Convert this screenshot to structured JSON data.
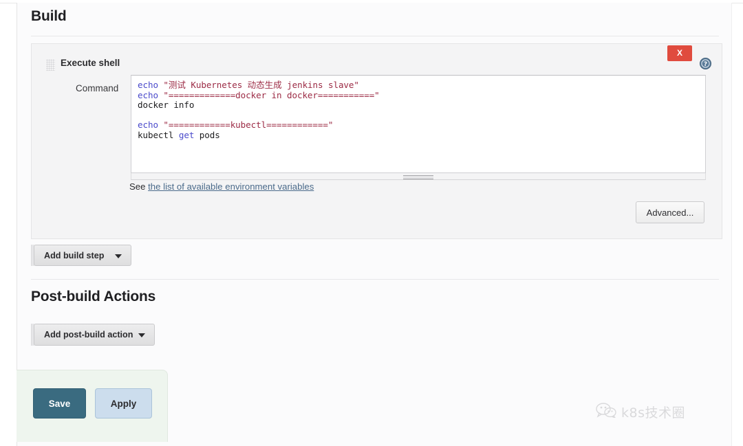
{
  "sections": {
    "build": {
      "title": "Build",
      "step": {
        "name": "Execute shell",
        "delete_label": "X",
        "help_icon": "help-circle-icon",
        "grip_icon": "drag-grip-icon",
        "command_label": "Command",
        "command_value": "echo \"测试 Kubernetes 动态生成 jenkins slave\"\necho \"=============docker in docker===========\"\ndocker info\n\necho \"============kubectl============\"\nkubectl get pods",
        "command_lines": [
          {
            "tokens": [
              {
                "type": "kw",
                "text": "echo "
              },
              {
                "type": "str",
                "text": "\"测试 Kubernetes 动态生成 jenkins slave\""
              }
            ]
          },
          {
            "tokens": [
              {
                "type": "kw",
                "text": "echo "
              },
              {
                "type": "str",
                "text": "\"=============docker in docker===========\""
              }
            ]
          },
          {
            "tokens": [
              {
                "type": "plain",
                "text": "docker info"
              }
            ]
          },
          {
            "tokens": [
              {
                "type": "plain",
                "text": ""
              }
            ]
          },
          {
            "tokens": [
              {
                "type": "kw",
                "text": "echo "
              },
              {
                "type": "str",
                "text": "\"============kubectl============\""
              }
            ]
          },
          {
            "tokens": [
              {
                "type": "plain",
                "text": "kubectl "
              },
              {
                "type": "kw",
                "text": "get"
              },
              {
                "type": "plain",
                "text": " pods"
              }
            ]
          }
        ],
        "env_prefix": "See ",
        "env_link_text": "the list of available environment variables",
        "advanced_label": "Advanced..."
      },
      "add_step_label": "Add build step"
    },
    "post_build": {
      "title": "Post-build Actions",
      "add_action_label": "Add post-build action"
    }
  },
  "footer": {
    "save_label": "Save",
    "apply_label": "Apply"
  },
  "watermark": {
    "icon": "wechat-icon",
    "text": "k8s技术圈"
  },
  "colors": {
    "delete_red": "#e04b3e",
    "save_teal": "#3a6b80",
    "apply_blue": "#ccdded",
    "link_blue": "#4a6a8a",
    "code_keyword": "#4a4acb",
    "code_string": "#9c2b45",
    "save_bar_bg": "#eef5ee"
  }
}
